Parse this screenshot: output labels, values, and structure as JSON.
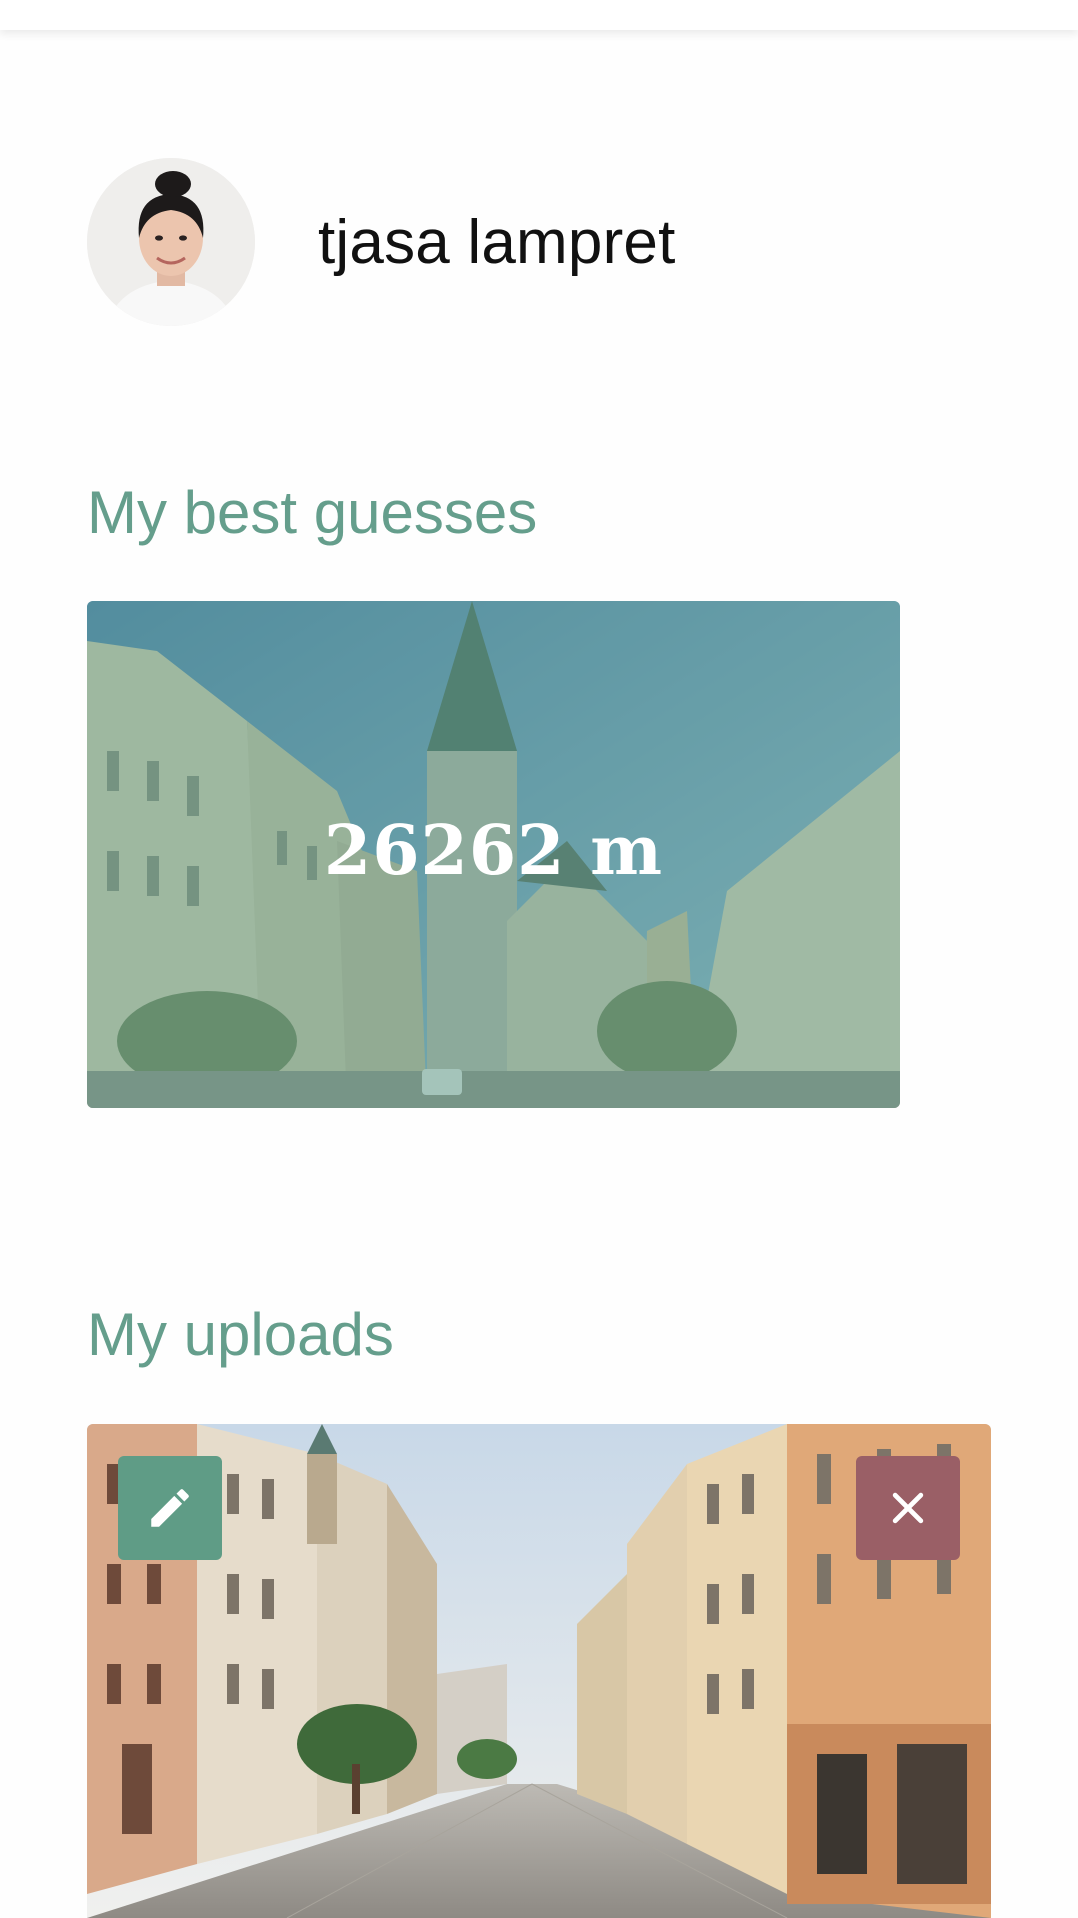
{
  "profile": {
    "name": "tjasa lampret",
    "avatar_icon": "avatar-photo"
  },
  "sections": {
    "best_guesses_title": "My best guesses",
    "uploads_title": "My uploads"
  },
  "best_guesses": [
    {
      "distance_label": "26262 m"
    }
  ],
  "uploads": [
    {
      "edit_icon": "pencil-icon",
      "delete_icon": "close-icon"
    }
  ],
  "colors": {
    "accent": "#659e8c",
    "edit_button": "#5f9c86",
    "delete_button": "#9a5f66"
  }
}
